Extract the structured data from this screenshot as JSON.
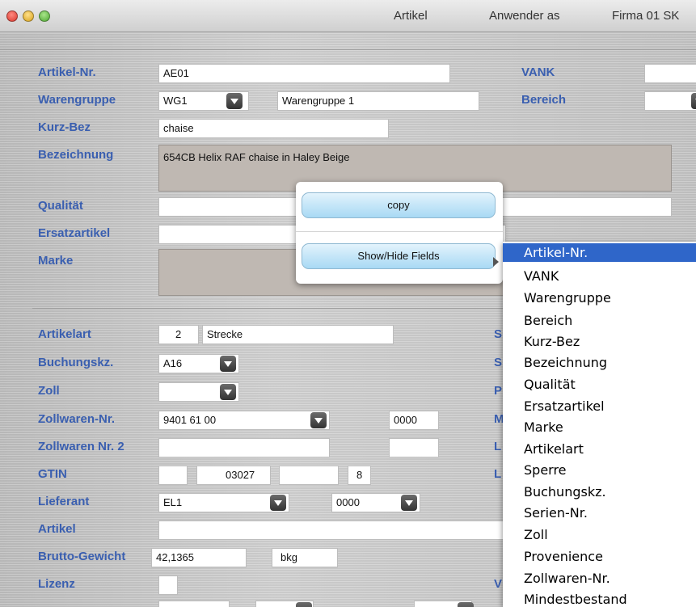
{
  "titlebar": {
    "module": "Artikel",
    "user": "Anwender as",
    "company": "Firma 01 SK"
  },
  "labels": {
    "artikel_nr": "Artikel-Nr.",
    "vank": "VANK",
    "warengruppe": "Warengruppe",
    "bereich": "Bereich",
    "kurz_bez": "Kurz-Bez",
    "bezeichnung": "Bezeichnung",
    "qualitaet": "Qualität",
    "ersatzartikel": "Ersatzartikel",
    "marke": "Marke",
    "artikelart": "Artikelart",
    "buchungskz": "Buchungskz.",
    "zoll": "Zoll",
    "zollwaren_nr": "Zollwaren-Nr.",
    "zollwaren_nr2": "Zollwaren Nr. 2",
    "gtin": "GTIN",
    "lieferant": "Lieferant",
    "artikel": "Artikel",
    "brutto_gewicht": "Brutto-Gewicht",
    "lizenz": "Lizenz"
  },
  "right_partial_labels": [
    "S",
    "S",
    "P",
    "M",
    "L",
    "L",
    "V"
  ],
  "fields": {
    "artikel_nr": "AE01",
    "warengruppe_code": "WG1",
    "warengruppe_name": "Warengruppe 1",
    "kurz_bez": "chaise",
    "bezeichnung": "654CB Helix RAF chaise in Haley Beige",
    "artikelart_code": "2",
    "artikelart_name": "Strecke",
    "buchungskz": "A16",
    "zollwaren_nr": "9401 61 00",
    "zollwaren_suffix": "0000",
    "gtin_part2": "03027",
    "gtin_check": "8",
    "lieferant": "EL1",
    "lieferant_sub": "0000",
    "brutto_gewicht": "42,1365",
    "gewicht_unit": "bkg"
  },
  "context_menu": {
    "copy": "copy",
    "show_hide": "Show/Hide Fields"
  },
  "submenu": {
    "items": [
      "Artikel-Nr.",
      "VANK",
      "Warengruppe",
      "Bereich",
      "Kurz-Bez",
      "Bezeichnung",
      "Qualität",
      "Ersatzartikel",
      "Marke",
      "Artikelart",
      "Sperre",
      "Buchungskz.",
      "Serien-Nr.",
      "Zoll",
      "Provenience",
      "Zollwaren-Nr.",
      "Mindestbestand"
    ],
    "selected": "Artikel-Nr."
  },
  "colors": {
    "label": "#3a5fb0",
    "selection": "#2f66c9"
  }
}
